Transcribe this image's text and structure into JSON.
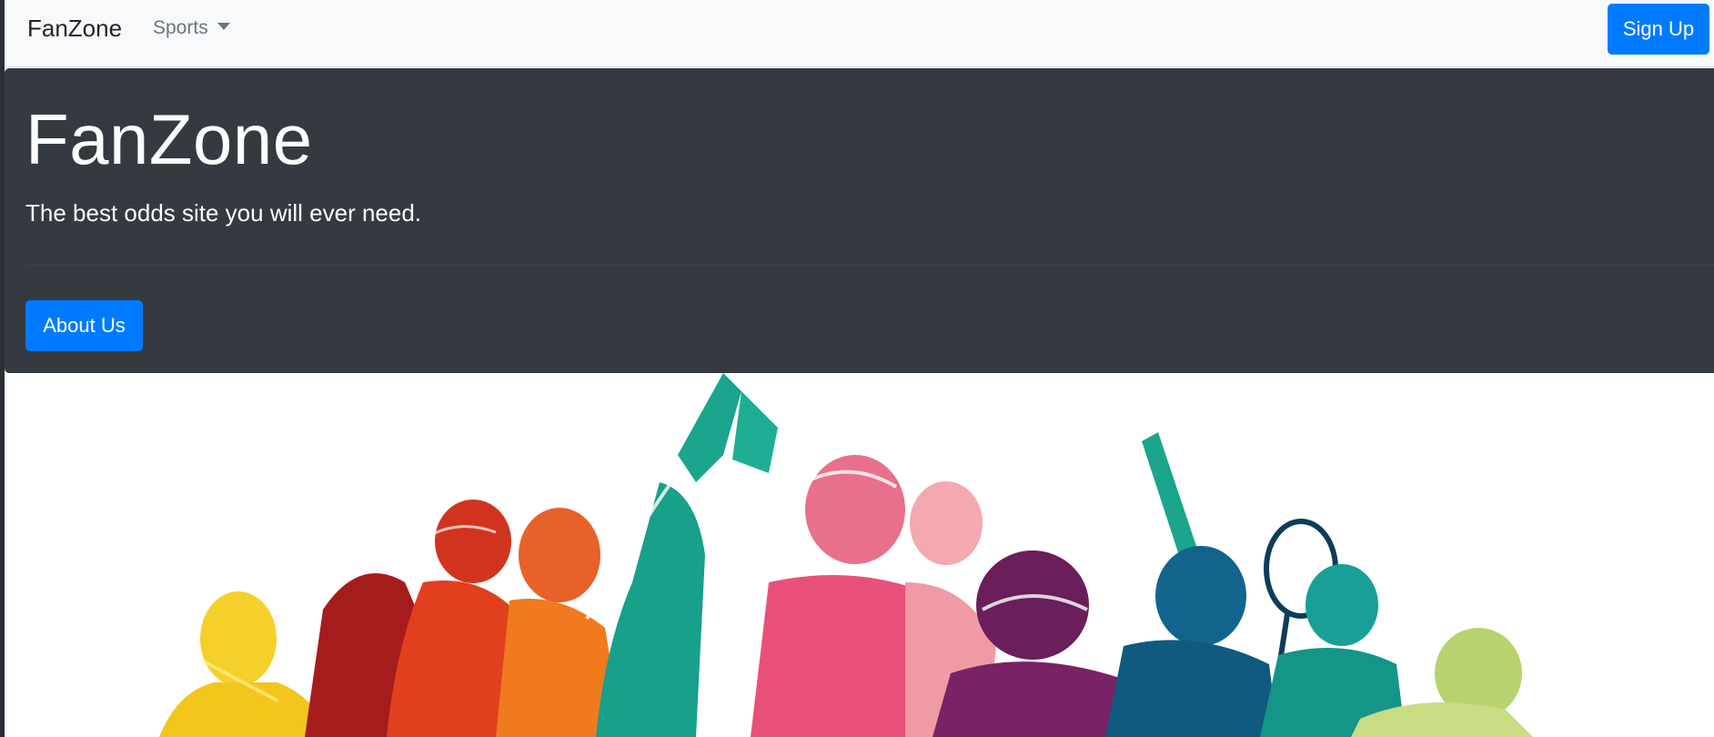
{
  "navbar": {
    "brand": "FanZone",
    "dropdown_label": "Sports",
    "signup_label": "Sign Up"
  },
  "hero": {
    "title": "FanZone",
    "lead": "The best odds site you will ever need.",
    "about_label": "About Us"
  },
  "colors": {
    "primary": "#007bff",
    "navbar_bg": "#f8f9fa",
    "jumbotron_bg": "#343a40",
    "silhouette_palette": [
      "#f5d02a",
      "#c8281e",
      "#e8502a",
      "#f07a1e",
      "#1aa58c",
      "#e8507a",
      "#f4a0a8",
      "#6a1e5a",
      "#12648c",
      "#18a096",
      "#b8d26e"
    ]
  },
  "image": {
    "icon": "sports-silhouettes-illustration"
  }
}
